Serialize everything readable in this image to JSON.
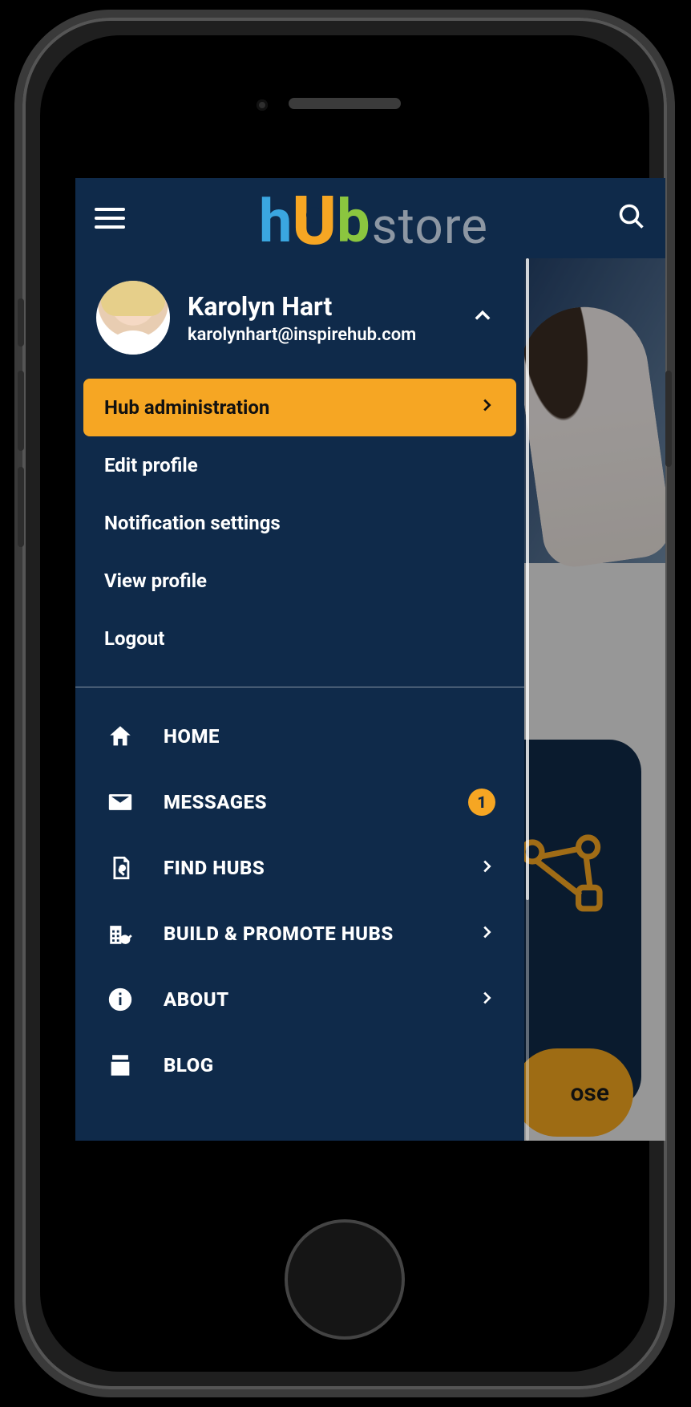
{
  "brand": {
    "h": "h",
    "u": "U",
    "b": "b",
    "rest": "store"
  },
  "user": {
    "name": "Karolyn Hart",
    "email": "karolynhart@inspirehub.com"
  },
  "profile_menu": {
    "hub_admin": "Hub administration",
    "edit_profile": "Edit profile",
    "notification_settings": "Notification settings",
    "view_profile": "View profile",
    "logout": "Logout"
  },
  "nav": {
    "home": "HOME",
    "messages": "MESSAGES",
    "messages_badge": "1",
    "find_hubs": "FIND HUBS",
    "build": "BUILD & PROMOTE HUBS",
    "about": "ABOUT",
    "blog": "BLOG"
  },
  "fab_partial": "ose"
}
